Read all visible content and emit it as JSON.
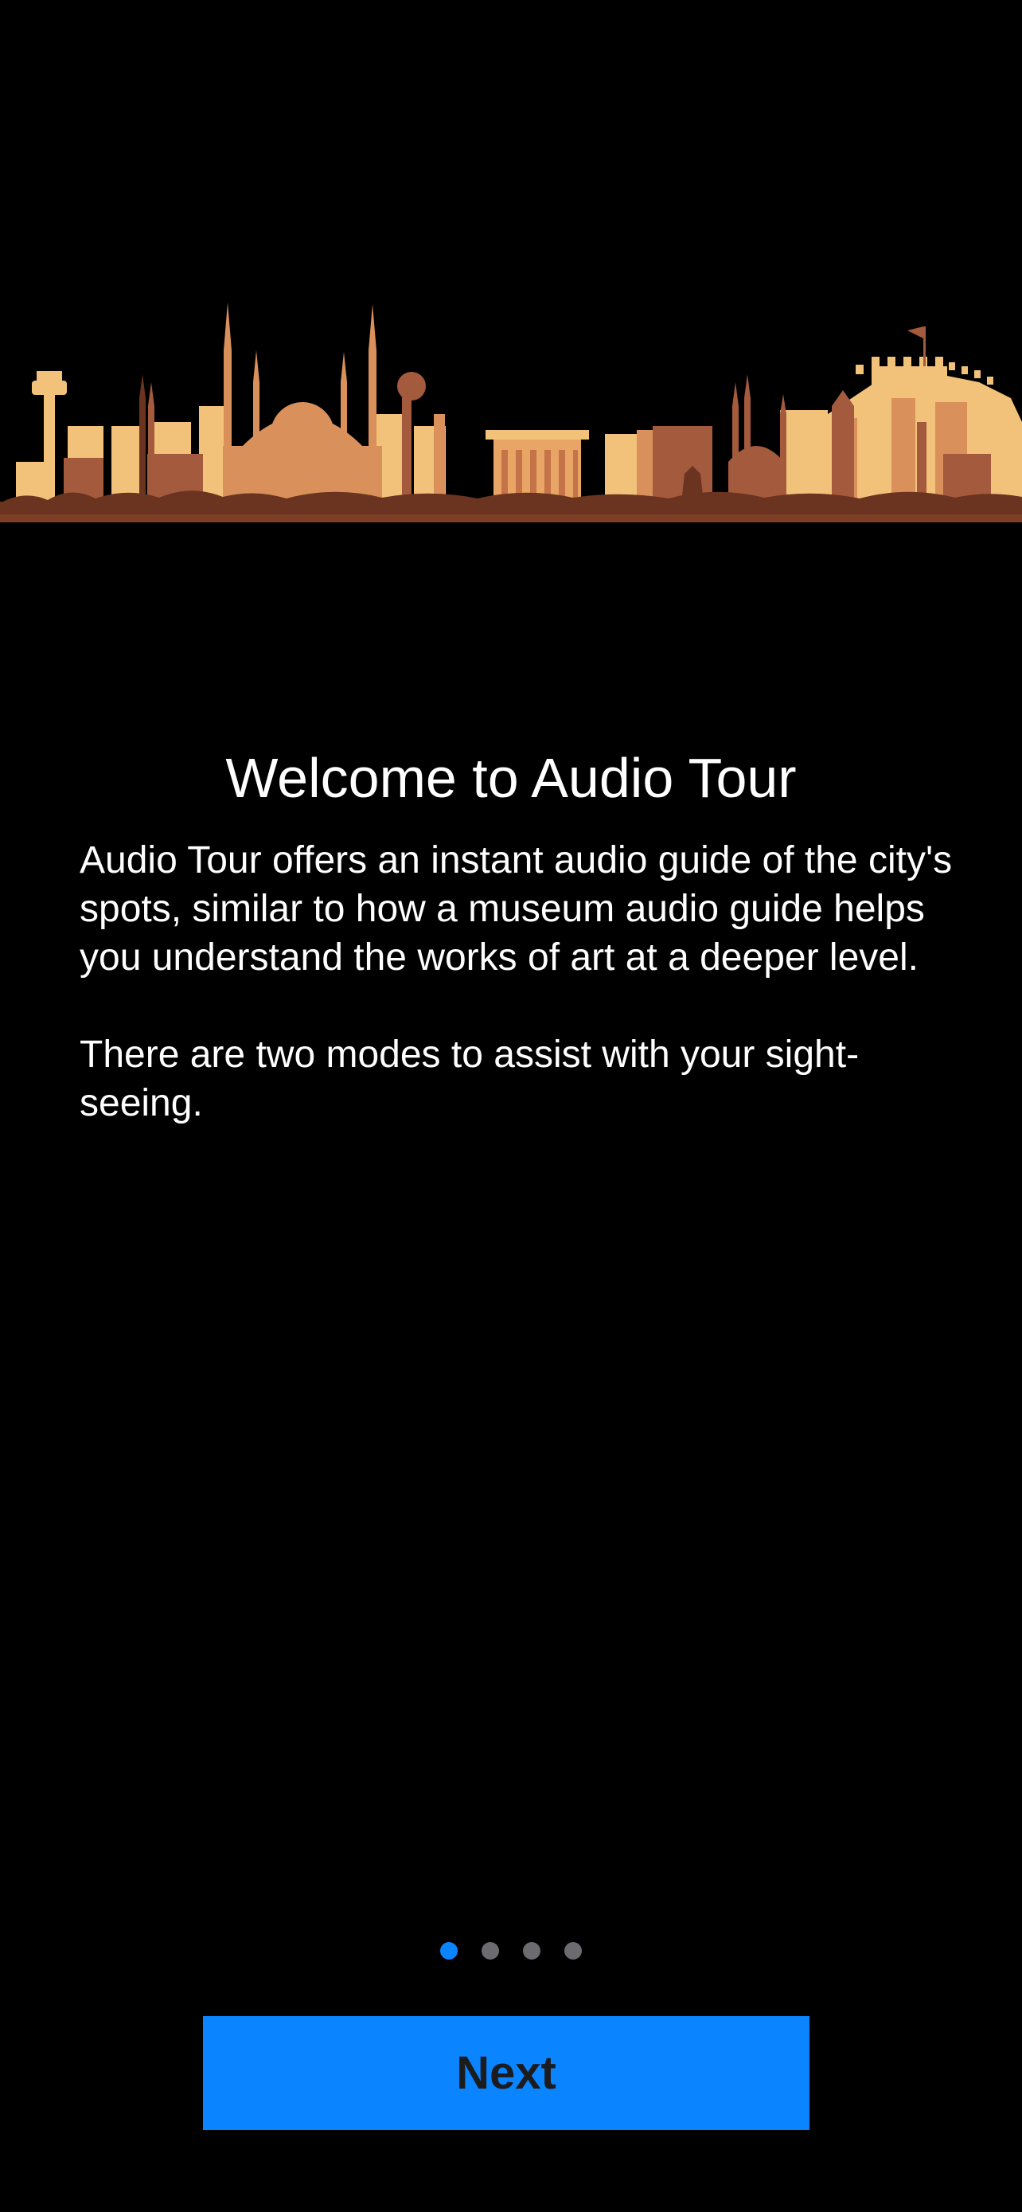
{
  "hero": {
    "image_name": "city-skyline-illustration",
    "colors": {
      "light": "#f2c27b",
      "mid": "#d9905a",
      "dark": "#a45a3c",
      "deep": "#6a3420"
    }
  },
  "onboarding": {
    "title": "Welcome to Audio Tour",
    "paragraphs": [
      "Audio Tour offers an instant audio guide of the city's spots, similar to how a museum audio guide helps you understand the works of art at a deeper level.",
      "There are two modes to assist with your sight-seeing."
    ]
  },
  "pager": {
    "total_pages": 4,
    "current_page": 1,
    "active_color": "#0a84ff",
    "inactive_color": "#6b6b70"
  },
  "actions": {
    "next_label": "Next",
    "button_color": "#0a84ff"
  }
}
